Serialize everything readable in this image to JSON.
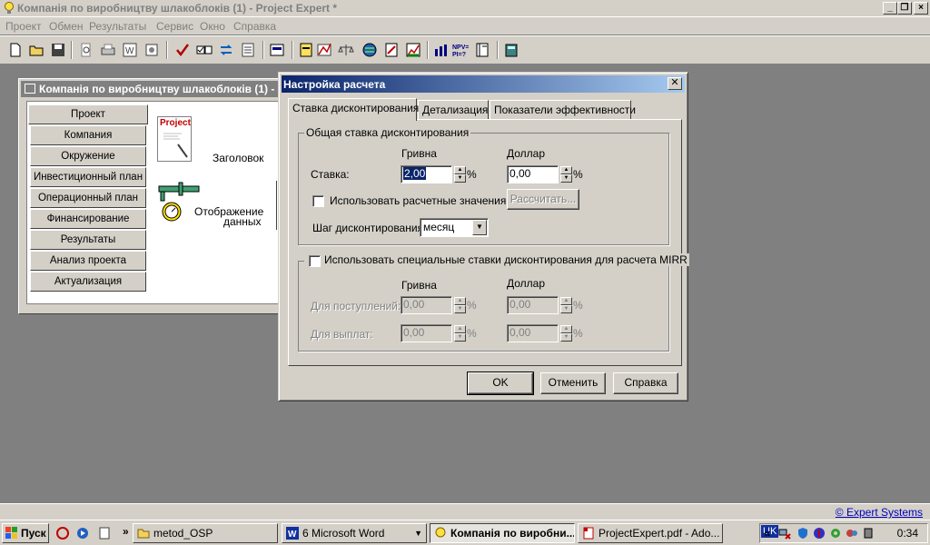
{
  "app": {
    "title": "Компанія по виробництву шлакоблоків (1) - Project Expert *",
    "menu": [
      "Проект",
      "Обмен",
      "Результаты",
      "Сервис",
      "Окно",
      "Справка"
    ]
  },
  "mdi_window": {
    "title": "Компанія по виробництву шлакоблоків (1) - (",
    "nav": [
      "Проект",
      "Компания",
      "Окружение",
      "Инвестиционный план",
      "Операционный план",
      "Финансирование",
      "Результаты",
      "Анализ проекта",
      "Актуализация"
    ],
    "project_icon_label": "Project",
    "item_header": "Заголовок",
    "item_display_line1": "Отображение",
    "item_display_line2": "данных"
  },
  "dialog": {
    "title": "Настройка расчета",
    "tabs": [
      "Ставка дисконтирования",
      "Детализация",
      "Показатели эффективности"
    ],
    "general_group": {
      "title": "Общая ставка дисконтирования",
      "col_uah": "Гривна",
      "col_usd": "Доллар",
      "rate_label": "Ставка:",
      "rate_uah": "2,00",
      "rate_usd": "0,00",
      "percent": "%",
      "use_calc_label": "Использовать расчетные значения",
      "use_calc_checked": false,
      "calc_button": "Рассчитать...",
      "step_label": "Шаг дисконтирования:",
      "step_value": "месяц"
    },
    "mirr_group": {
      "title": "Использовать специальные ставки дисконтирования для расчета MIRR",
      "checked": false,
      "col_uah": "Гривна",
      "col_usd": "Доллар",
      "inflow_label": "Для поступлений:",
      "inflow_uah": "0,00",
      "inflow_usd": "0,00",
      "outflow_label": "Для выплат:",
      "outflow_uah": "0,00",
      "outflow_usd": "0,00",
      "percent": "%"
    },
    "buttons": {
      "ok": "OK",
      "cancel": "Отменить",
      "help": "Справка"
    }
  },
  "statusbar": {
    "link": "© Expert Systems"
  },
  "taskbar": {
    "start": "Пуск",
    "tasks": [
      "metod_OSP",
      "6 Microsoft Word",
      "Компанія по виробни...",
      "ProjectExpert.pdf - Ado..."
    ],
    "lang": "UK",
    "clock": "0:34"
  }
}
